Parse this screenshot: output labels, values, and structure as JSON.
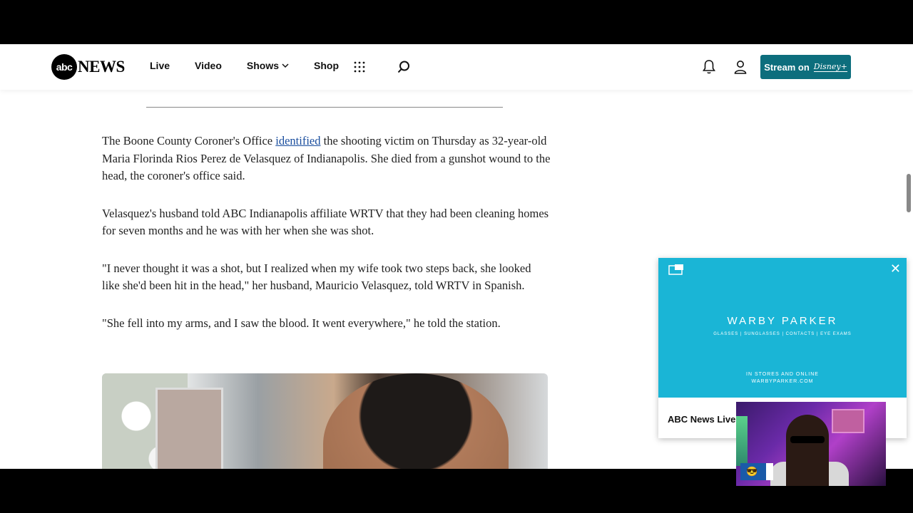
{
  "header": {
    "logo_abc": "abc",
    "logo_news": "NEWS",
    "nav": [
      "Live",
      "Video",
      "Shows",
      "Shop"
    ],
    "stream_label": "Stream on",
    "stream_brand": "Disney+"
  },
  "article": {
    "p1_before": "The Boone County Coroner's Office ",
    "p1_link": "identified",
    "p1_after": " the shooting victim on Thursday as 32-year-old Maria Florinda Rios Perez de Velasquez of Indianapolis. She died from a gunshot wound to the head, the coroner's office said.",
    "p2": "Velasquez's husband told ABC Indianapolis affiliate WRTV that they had been cleaning homes for seven months and he was with her when she was shot.",
    "p3": "\"I never thought it was a shot, but I realized when my wife took two steps back, she looked like she'd been hit in the head,\" her husband, Mauricio Velasquez, told WRTV in Spanish.",
    "p4": "\"She fell into my arms, and I saw the blood. It went everywhere,\" he told the station."
  },
  "ad": {
    "brand": "WARBY PARKER",
    "sub": "GLASSES  |  SUNGLASSES  |  CONTACTS  |  EYE EXAMS",
    "line1": "IN STORES AND ONLINE",
    "line2": "WARBYPARKER.COM",
    "label": "ABC News Live",
    "close": "✕"
  },
  "webcam": {
    "badge_emoji": "😎"
  },
  "colors": {
    "accent": "#0d6e7d",
    "ad_bg": "#1ab5d6",
    "link": "#1a4e9e"
  },
  "icons": [
    "apps-grid-icon",
    "search-icon",
    "bell-icon",
    "user-icon",
    "picture-in-picture-icon",
    "close-icon",
    "chevron-down-icon"
  ]
}
